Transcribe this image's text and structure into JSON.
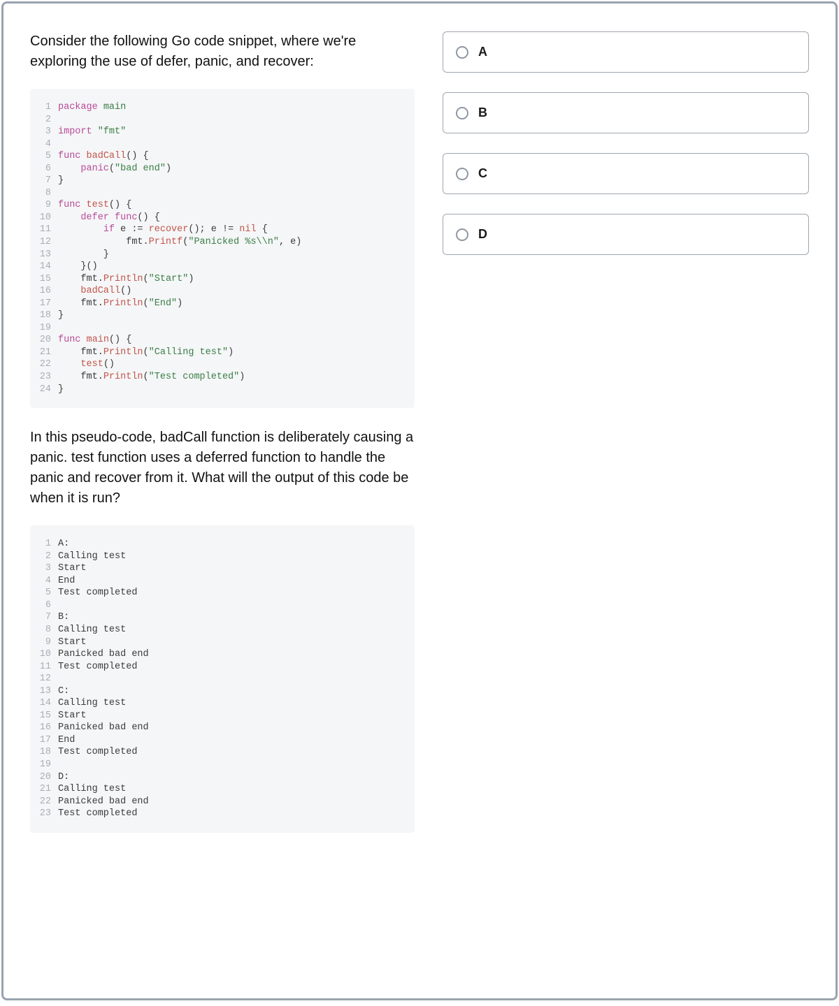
{
  "question": {
    "intro": "Consider the following Go code snippet, where we're exploring the use of defer, panic, and recover:",
    "followup": "In this pseudo-code, badCall function is deliberately causing a panic. test function uses a deferred function to handle the panic and recover from it. What will the output of this code be when it is run?"
  },
  "code": {
    "lines": [
      [
        {
          "t": "package ",
          "c": "tok-kw"
        },
        {
          "t": "main",
          "c": "tok-pkg"
        }
      ],
      [],
      [
        {
          "t": "import ",
          "c": "tok-kw"
        },
        {
          "t": "\"fmt\"",
          "c": "tok-str"
        }
      ],
      [],
      [
        {
          "t": "func ",
          "c": "tok-kw"
        },
        {
          "t": "badCall",
          "c": "tok-var"
        },
        {
          "t": "() {",
          "c": "tok-plain"
        }
      ],
      [
        {
          "t": "    ",
          "c": ""
        },
        {
          "t": "panic",
          "c": "tok-id2"
        },
        {
          "t": "(",
          "c": "tok-plain"
        },
        {
          "t": "\"bad end\"",
          "c": "tok-str"
        },
        {
          "t": ")",
          "c": "tok-plain"
        }
      ],
      [
        {
          "t": "}",
          "c": "tok-plain"
        }
      ],
      [],
      [
        {
          "t": "func ",
          "c": "tok-kw"
        },
        {
          "t": "test",
          "c": "tok-var"
        },
        {
          "t": "() {",
          "c": "tok-plain"
        }
      ],
      [
        {
          "t": "    ",
          "c": ""
        },
        {
          "t": "defer ",
          "c": "tok-kw"
        },
        {
          "t": "func",
          "c": "tok-kw"
        },
        {
          "t": "() {",
          "c": "tok-plain"
        }
      ],
      [
        {
          "t": "        ",
          "c": ""
        },
        {
          "t": "if ",
          "c": "tok-kw"
        },
        {
          "t": "e := ",
          "c": "tok-plain"
        },
        {
          "t": "recover",
          "c": "tok-var"
        },
        {
          "t": "(); e != ",
          "c": "tok-plain"
        },
        {
          "t": "nil",
          "c": "tok-var"
        },
        {
          "t": " {",
          "c": "tok-plain"
        }
      ],
      [
        {
          "t": "            fmt.",
          "c": "tok-plain"
        },
        {
          "t": "Printf",
          "c": "tok-var"
        },
        {
          "t": "(",
          "c": "tok-plain"
        },
        {
          "t": "\"Panicked %s\\\\n\"",
          "c": "tok-str"
        },
        {
          "t": ", e)",
          "c": "tok-plain"
        }
      ],
      [
        {
          "t": "        }",
          "c": "tok-plain"
        }
      ],
      [
        {
          "t": "    }()",
          "c": "tok-plain"
        }
      ],
      [
        {
          "t": "    fmt.",
          "c": "tok-plain"
        },
        {
          "t": "Println",
          "c": "tok-var"
        },
        {
          "t": "(",
          "c": "tok-plain"
        },
        {
          "t": "\"Start\"",
          "c": "tok-str"
        },
        {
          "t": ")",
          "c": "tok-plain"
        }
      ],
      [
        {
          "t": "    ",
          "c": ""
        },
        {
          "t": "badCall",
          "c": "tok-var"
        },
        {
          "t": "()",
          "c": "tok-plain"
        }
      ],
      [
        {
          "t": "    fmt.",
          "c": "tok-plain"
        },
        {
          "t": "Println",
          "c": "tok-var"
        },
        {
          "t": "(",
          "c": "tok-plain"
        },
        {
          "t": "\"End\"",
          "c": "tok-str"
        },
        {
          "t": ")",
          "c": "tok-plain"
        }
      ],
      [
        {
          "t": "}",
          "c": "tok-plain"
        }
      ],
      [],
      [
        {
          "t": "func ",
          "c": "tok-kw"
        },
        {
          "t": "main",
          "c": "tok-var"
        },
        {
          "t": "() {",
          "c": "tok-plain"
        }
      ],
      [
        {
          "t": "    fmt.",
          "c": "tok-plain"
        },
        {
          "t": "Println",
          "c": "tok-var"
        },
        {
          "t": "(",
          "c": "tok-plain"
        },
        {
          "t": "\"Calling test\"",
          "c": "tok-str"
        },
        {
          "t": ")",
          "c": "tok-plain"
        }
      ],
      [
        {
          "t": "    ",
          "c": ""
        },
        {
          "t": "test",
          "c": "tok-var"
        },
        {
          "t": "()",
          "c": "tok-plain"
        }
      ],
      [
        {
          "t": "    fmt.",
          "c": "tok-plain"
        },
        {
          "t": "Println",
          "c": "tok-var"
        },
        {
          "t": "(",
          "c": "tok-plain"
        },
        {
          "t": "\"Test completed\"",
          "c": "tok-str"
        },
        {
          "t": ")",
          "c": "tok-plain"
        }
      ],
      [
        {
          "t": "}",
          "c": "tok-plain"
        }
      ]
    ]
  },
  "answers_block": {
    "lines": [
      "A:",
      "Calling test",
      "Start",
      "End",
      "Test completed",
      "",
      "B:",
      "Calling test",
      "Start",
      "Panicked bad end",
      "Test completed",
      "",
      "C:",
      "Calling test",
      "Start",
      "Panicked bad end",
      "End",
      "Test completed",
      "",
      "D:",
      "Calling test",
      "Panicked bad end",
      "Test completed"
    ]
  },
  "options": [
    {
      "label": "A"
    },
    {
      "label": "B"
    },
    {
      "label": "C"
    },
    {
      "label": "D"
    }
  ]
}
